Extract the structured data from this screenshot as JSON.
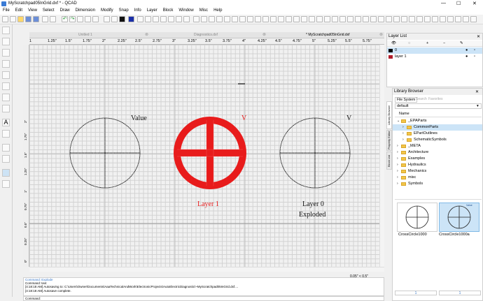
{
  "window": {
    "title": "MyScratchpad05InGrid.dxf * - QCAD"
  },
  "menu": [
    "File",
    "Edit",
    "View",
    "Select",
    "Draw",
    "Dimension",
    "Modify",
    "Snap",
    "Info",
    "Layer",
    "Block",
    "Window",
    "Misc",
    "Help"
  ],
  "tabs": [
    "Unitled 1",
    "Diagnostics.dxf",
    "* MyScratchpad05InGrid.dxf"
  ],
  "ruler_top": [
    "1",
    "1.25\"",
    "1.5\"",
    "1.75\"",
    "2\"",
    "2.25\"",
    "2.5\"",
    "2.75\"",
    "3\"",
    "3.25\"",
    "3.5\"",
    "3.75\"",
    "4\"",
    "4.25\"",
    "4.5\"",
    "4.75\"",
    "5\"",
    "5.25\"",
    "5.5\"",
    "5.75\""
  ],
  "ruler_left": [
    "2\"",
    "1.75\"",
    "1.5\"",
    "1.25\"",
    "1\"",
    "0.75\"",
    "0.5\"",
    "0.25\"",
    "0\"",
    "-0.25\"",
    "-0.5\"",
    "-0.75\"",
    "-1\"",
    "-1.25\"",
    "-1.5\"",
    "-1.75\""
  ],
  "drawing": {
    "label_value": "Value",
    "label_v_red": "V",
    "label_v": "V",
    "label_layer1": "Layer 1",
    "label_layer0": "Layer 0",
    "label_exploded": "Exploded",
    "red_color": "#e81b1b"
  },
  "status": {
    "coords": "0.05\" < 0.5\""
  },
  "command_history": [
    "Command: Explode",
    "Command: text",
    "[4:18:18 AM] Autosaving to: C:\\Users\\Owner\\Documents\\AaaTechnicalAndWork\\ElectronicProjects\\AutoElectricDiagnostic\\~MyScratchpad05InGrid.dxf....",
    "[4:18:18 AM] Autosave complete."
  ],
  "command_prompt": "Command:",
  "layer_list": {
    "title": "Layer List",
    "layers": [
      {
        "name": "0",
        "color": "#000000",
        "selected": true
      },
      {
        "name": "layer 1",
        "color": "#b01e2c",
        "selected": false
      }
    ]
  },
  "library": {
    "title": "Library Browser",
    "tabs": [
      "File System",
      "Search",
      "Favorites"
    ],
    "source": "default",
    "column_header": "Name",
    "side_tabs": [
      "Library Browser",
      "Property Editor",
      "Block List"
    ],
    "tree": [
      {
        "name": "_EPAParts",
        "indent": 0
      },
      {
        "name": "CommonParts",
        "indent": 1
      },
      {
        "name": "EPartOutlines",
        "indent": 1
      },
      {
        "name": "SchematicSymbols",
        "indent": 1
      },
      {
        "name": "_META",
        "indent": 0
      },
      {
        "name": "Architecture",
        "indent": 0
      },
      {
        "name": "Examples",
        "indent": 0
      },
      {
        "name": "Hydraulics",
        "indent": 0
      },
      {
        "name": "Mechanics",
        "indent": 0
      },
      {
        "name": "misc",
        "indent": 0
      },
      {
        "name": "Symbols",
        "indent": 0
      }
    ],
    "thumbs": [
      {
        "name": "CrossCircle1000"
      },
      {
        "name": "CrossCircle1000a",
        "badge": "Value"
      }
    ],
    "page_buttons": [
      "1",
      "1"
    ]
  }
}
